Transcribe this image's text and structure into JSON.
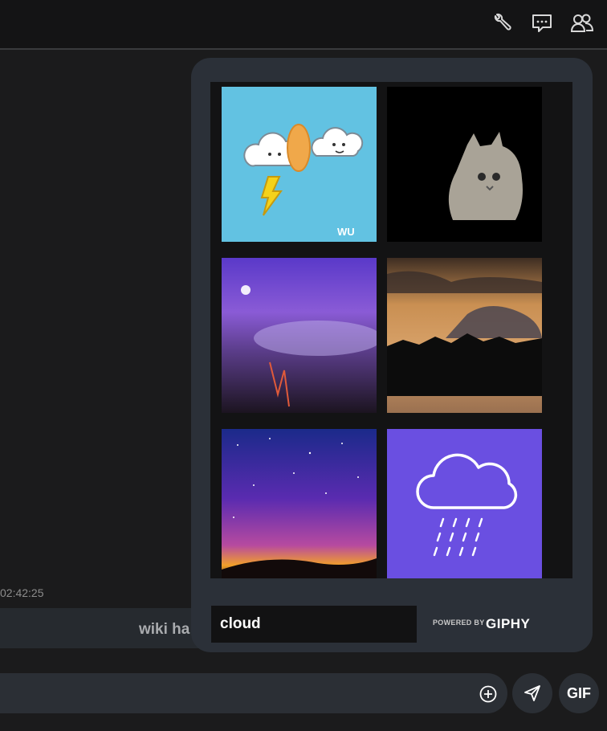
{
  "header": {
    "icons": [
      "wrench-icon",
      "chat-bubble-icon",
      "members-icon"
    ]
  },
  "chat": {
    "timestamp": "02:42:25",
    "message_text": "wiki ha"
  },
  "composer": {
    "gif_button_label": "GIF"
  },
  "gif_picker": {
    "search_value": "cloud",
    "powered_by_label": "POWERED BY",
    "brand_label": "GIPHY",
    "tile_watermark": "WU",
    "results": [
      {
        "name": "angry-cloud-lightning"
      },
      {
        "name": "fluffy-cat-black-background"
      },
      {
        "name": "purple-clouds-city-lights"
      },
      {
        "name": "sunset-clouds-silhouette"
      },
      {
        "name": "starry-sky-sunset"
      },
      {
        "name": "rain-cloud-purple"
      }
    ]
  },
  "colors": {
    "panel_bg": "#2b3038",
    "grid_bg": "#131314",
    "rain_tile": "#6a4fe1",
    "app_bg": "#1b1b1c"
  }
}
